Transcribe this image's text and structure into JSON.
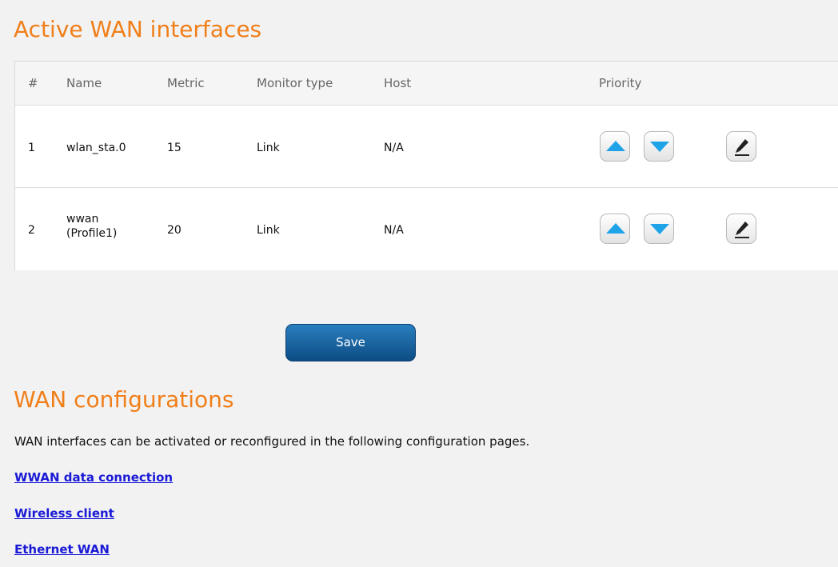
{
  "active_wan": {
    "title": "Active WAN interfaces",
    "columns": {
      "index": "#",
      "name": "Name",
      "metric": "Metric",
      "monitor_type": "Monitor type",
      "host": "Host",
      "priority": "Priority"
    },
    "rows": [
      {
        "index": "1",
        "name_line1": "wlan_sta.0",
        "name_line2": "",
        "metric": "15",
        "monitor_type": "Link",
        "host": "N/A"
      },
      {
        "index": "2",
        "name_line1": "wwan",
        "name_line2": "(Profile1)",
        "metric": "20",
        "monitor_type": "Link",
        "host": "N/A"
      }
    ],
    "icons": {
      "up": "arrow-up-icon",
      "down": "arrow-down-icon",
      "edit": "pencil-icon"
    },
    "save_label": "Save"
  },
  "wan_config": {
    "title": "WAN configurations",
    "description": "WAN interfaces can be activated or reconfigured in the following configuration pages.",
    "links": [
      {
        "label": "WWAN data connection"
      },
      {
        "label": "Wireless client"
      },
      {
        "label": "Ethernet WAN"
      }
    ]
  },
  "colors": {
    "heading": "#f07f1a",
    "arrow": "#1fa3e8",
    "save_button": "#1560a0",
    "link": "#1a1ad6",
    "background": "#f2f2f2"
  }
}
